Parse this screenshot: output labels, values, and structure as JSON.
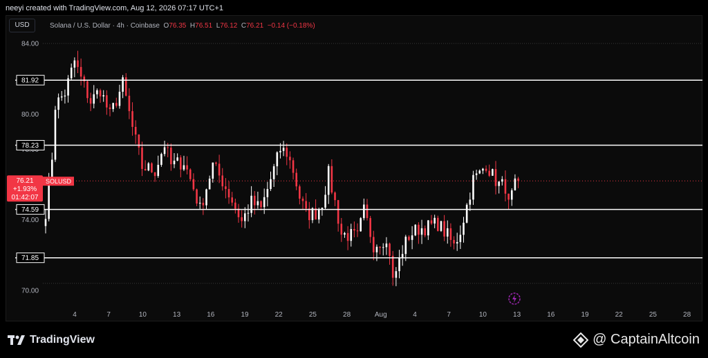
{
  "header": {
    "title": "neeyi created with TradingView.com, Aug 12, 2026 07:17 UTC+1"
  },
  "toolbar": {
    "currency": "USD"
  },
  "legend": {
    "symbol": "Solana / U.S. Dollar · 4h · Coinbase",
    "o_label": "O",
    "o_value": "76.35",
    "h_label": "H",
    "h_value": "76.51",
    "l_label": "L",
    "l_value": "76.12",
    "c_label": "C",
    "c_value": "76.21",
    "change": "−0.14 (−0.18%)"
  },
  "price_badge": {
    "price": "76.21",
    "change_pct": "+1.93%",
    "countdown": "01:42:07",
    "ticker": "SOLUSD"
  },
  "branding": {
    "tradingview": "TradingView",
    "watermark": "@ CaptainAltcoin"
  },
  "colors": {
    "up": "#ffffff",
    "down": "#f23645",
    "background": "#000000",
    "level_line": "#ffffff"
  },
  "icons": {
    "flash": "lightning-bolt-icon",
    "logo": "tradingview-logo-icon",
    "watermark": "diamond-logo-icon"
  },
  "chart_data": {
    "type": "candlestick",
    "symbol": "SOLUSD",
    "interval": "4h",
    "ylim": [
      69.8,
      84.4
    ],
    "yticks": [
      "84.00",
      "80.00",
      "78.00",
      "76.00",
      "74.00",
      "70.00"
    ],
    "xtick_labels": [
      "4",
      "7",
      "10",
      "13",
      "16",
      "19",
      "22",
      "25",
      "28",
      "Aug",
      "4",
      "7",
      "10",
      "13",
      "16",
      "19",
      "22",
      "25",
      "28"
    ],
    "horizontal_levels": [
      {
        "label": "81.92",
        "value": 81.92
      },
      {
        "label": "78.23",
        "value": 78.23
      },
      {
        "label": "74.59",
        "value": 74.59
      },
      {
        "label": "71.85",
        "value": 71.85
      }
    ],
    "dotted_levels": [
      84.0,
      76.21,
      70.4
    ],
    "current_price": 76.21,
    "path_anchors": [
      [
        0,
        74.5
      ],
      [
        2,
        77.6
      ],
      [
        3,
        80.5
      ],
      [
        6,
        81.2
      ],
      [
        9,
        83.0
      ],
      [
        11,
        82.0
      ],
      [
        14,
        80.7
      ],
      [
        17,
        81.4
      ],
      [
        20,
        79.9
      ],
      [
        24,
        81.7
      ],
      [
        27,
        79.2
      ],
      [
        30,
        77.0
      ],
      [
        34,
        76.8
      ],
      [
        37,
        78.3
      ],
      [
        39,
        77.1
      ],
      [
        43,
        77.3
      ],
      [
        46,
        75.8
      ],
      [
        48,
        74.6
      ],
      [
        52,
        77.1
      ],
      [
        55,
        76.2
      ],
      [
        58,
        75.1
      ],
      [
        61,
        73.9
      ],
      [
        64,
        75.0
      ],
      [
        67,
        74.6
      ],
      [
        70,
        76.3
      ],
      [
        73,
        78.0
      ],
      [
        75,
        77.8
      ],
      [
        77,
        76.8
      ],
      [
        79,
        75.3
      ],
      [
        81,
        74.3
      ],
      [
        84,
        74.4
      ],
      [
        86,
        75.0
      ],
      [
        88,
        76.6
      ],
      [
        90,
        75.0
      ],
      [
        92,
        73.2
      ],
      [
        95,
        73.1
      ],
      [
        97,
        73.0
      ],
      [
        99,
        74.5
      ],
      [
        102,
        72.6
      ],
      [
        105,
        72.9
      ],
      [
        107,
        72.2
      ],
      [
        108,
        70.5
      ],
      [
        111,
        72.3
      ],
      [
        113,
        73.1
      ],
      [
        116,
        73.5
      ],
      [
        119,
        73.6
      ],
      [
        122,
        73.8
      ],
      [
        125,
        73.1
      ],
      [
        127,
        72.5
      ],
      [
        129,
        73.4
      ],
      [
        131,
        74.8
      ],
      [
        133,
        76.3
      ],
      [
        135,
        76.6
      ],
      [
        137,
        77.2
      ],
      [
        139,
        76.5
      ],
      [
        141,
        76.0
      ],
      [
        143,
        75.9
      ],
      [
        144,
        74.8
      ],
      [
        146,
        75.9
      ],
      [
        147,
        76.21
      ]
    ]
  }
}
